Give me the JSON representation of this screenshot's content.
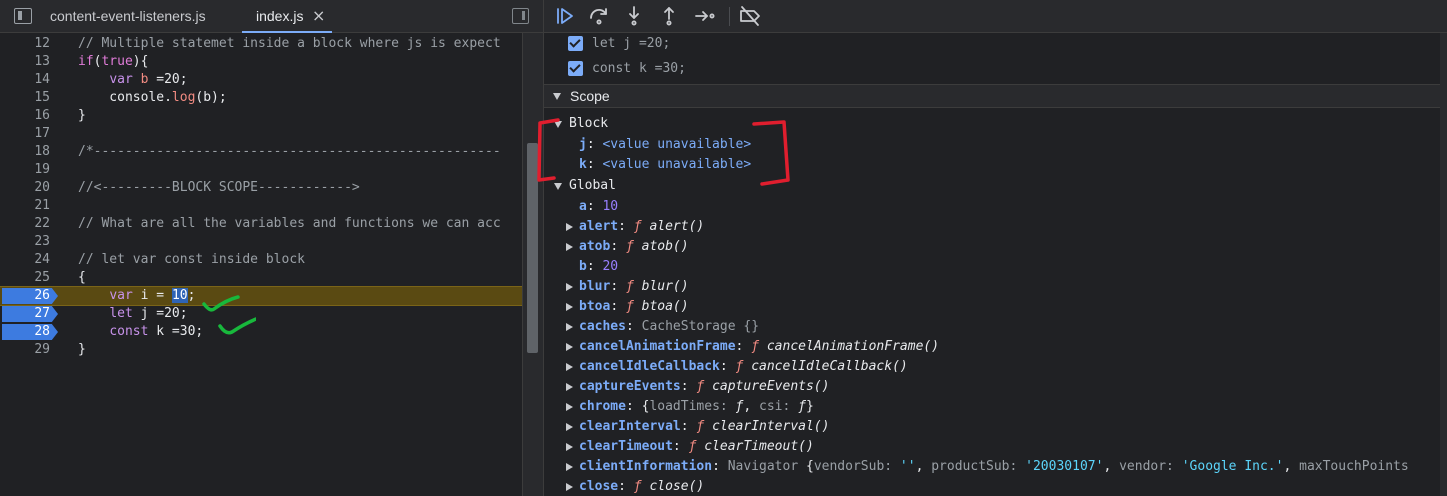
{
  "editor": {
    "tabs": [
      {
        "label": "content-event-listeners.js"
      },
      {
        "label": "index.js",
        "close": "×"
      }
    ],
    "lines": [
      {
        "n": "12",
        "parts": [
          {
            "c": "c-cm",
            "t": "// Multiple statemet inside a block where js is expect"
          }
        ]
      },
      {
        "n": "13",
        "parts": [
          {
            "c": "c-kw2",
            "t": "if"
          },
          {
            "c": "c-nm",
            "t": "("
          },
          {
            "c": "c-kw2",
            "t": "true"
          },
          {
            "c": "c-nm",
            "t": "){"
          }
        ]
      },
      {
        "n": "14",
        "parts": [
          {
            "c": "c-nm",
            "t": "    "
          },
          {
            "c": "c-kw",
            "t": "var"
          },
          {
            "c": "c-nm",
            "t": " "
          },
          {
            "c": "c-fn",
            "t": "b"
          },
          {
            "c": "c-nm",
            "t": " =20;"
          }
        ]
      },
      {
        "n": "15",
        "parts": [
          {
            "c": "c-nm",
            "t": "    console."
          },
          {
            "c": "c-fn",
            "t": "log"
          },
          {
            "c": "c-nm",
            "t": "(b);"
          }
        ]
      },
      {
        "n": "16",
        "parts": [
          {
            "c": "c-nm",
            "t": "}"
          }
        ]
      },
      {
        "n": "17",
        "parts": []
      },
      {
        "n": "18",
        "parts": [
          {
            "c": "c-cm",
            "t": "/*----------------------------------------------------"
          }
        ]
      },
      {
        "n": "19",
        "parts": []
      },
      {
        "n": "20",
        "parts": [
          {
            "c": "c-cm",
            "t": "//<---------BLOCK SCOPE------------>"
          }
        ]
      },
      {
        "n": "21",
        "parts": []
      },
      {
        "n": "22",
        "parts": [
          {
            "c": "c-cm",
            "t": "// What are all the variables and functions we can acc"
          }
        ]
      },
      {
        "n": "23",
        "parts": []
      },
      {
        "n": "24",
        "parts": [
          {
            "c": "c-cm",
            "t": "// let var const inside block"
          }
        ]
      },
      {
        "n": "25",
        "parts": [
          {
            "c": "c-nm",
            "t": "{"
          }
        ]
      },
      {
        "n": "26",
        "bp": true,
        "active": true,
        "parts": [
          {
            "c": "c-nm",
            "t": "    "
          },
          {
            "c": "c-kw",
            "t": "var"
          },
          {
            "c": "c-nm",
            "t": " i = "
          },
          {
            "c": "c-hl",
            "t": "10"
          },
          {
            "c": "c-nm",
            "t": ";"
          }
        ]
      },
      {
        "n": "27",
        "bp": true,
        "parts": [
          {
            "c": "c-nm",
            "t": "    "
          },
          {
            "c": "c-kw",
            "t": "let"
          },
          {
            "c": "c-nm",
            "t": " j =20;"
          }
        ]
      },
      {
        "n": "28",
        "bp": true,
        "parts": [
          {
            "c": "c-nm",
            "t": "    "
          },
          {
            "c": "c-kw",
            "t": "const"
          },
          {
            "c": "c-nm",
            "t": " k =30;"
          }
        ]
      },
      {
        "n": "29",
        "parts": [
          {
            "c": "c-nm",
            "t": "}"
          }
        ]
      }
    ]
  },
  "debugger": {
    "toolbar": [
      {
        "name": "resume-icon",
        "cls": "resume"
      },
      {
        "name": "step-over-icon",
        "cls": ""
      },
      {
        "name": "step-into-icon",
        "cls": ""
      },
      {
        "name": "step-out-icon",
        "cls": ""
      },
      {
        "name": "step-icon",
        "cls": ""
      },
      {
        "name": "deactivate-breakpoints-icon",
        "cls": ""
      }
    ],
    "watch": [
      {
        "label": "let j =20;"
      },
      {
        "label": "const k =30;"
      }
    ],
    "scope_title": "Scope",
    "block_title": "Block",
    "block_props": [
      {
        "key": "j",
        "value": "<value unavailable>"
      },
      {
        "key": "k",
        "value": "<value unavailable>"
      }
    ],
    "global_title": "Global",
    "global_props": [
      {
        "arrow": false,
        "key": "a",
        "parts": [
          {
            "c": "pnum",
            "t": "10"
          }
        ]
      },
      {
        "arrow": true,
        "key": "alert",
        "parts": [
          {
            "c": "pfk",
            "t": "ƒ "
          },
          {
            "c": "pfn",
            "t": "alert()"
          }
        ]
      },
      {
        "arrow": true,
        "key": "atob",
        "parts": [
          {
            "c": "pfk",
            "t": "ƒ "
          },
          {
            "c": "pfn",
            "t": "atob()"
          }
        ]
      },
      {
        "arrow": false,
        "key": "b",
        "parts": [
          {
            "c": "pnum",
            "t": "20"
          }
        ]
      },
      {
        "arrow": true,
        "key": "blur",
        "parts": [
          {
            "c": "pfk",
            "t": "ƒ "
          },
          {
            "c": "pfn",
            "t": "blur()"
          }
        ]
      },
      {
        "arrow": true,
        "key": "btoa",
        "parts": [
          {
            "c": "pfk",
            "t": "ƒ "
          },
          {
            "c": "pfn",
            "t": "btoa()"
          }
        ]
      },
      {
        "arrow": true,
        "key": "caches",
        "parts": [
          {
            "c": "pobj",
            "t": "CacheStorage {}"
          }
        ]
      },
      {
        "arrow": true,
        "key": "cancelAnimationFrame",
        "parts": [
          {
            "c": "pfk",
            "t": "ƒ "
          },
          {
            "c": "pfn",
            "t": "cancelAnimationFrame()"
          }
        ]
      },
      {
        "arrow": true,
        "key": "cancelIdleCallback",
        "parts": [
          {
            "c": "pfk",
            "t": "ƒ "
          },
          {
            "c": "pfn",
            "t": "cancelIdleCallback()"
          }
        ]
      },
      {
        "arrow": true,
        "key": "captureEvents",
        "parts": [
          {
            "c": "pfk",
            "t": "ƒ "
          },
          {
            "c": "pfn",
            "t": "captureEvents()"
          }
        ]
      },
      {
        "arrow": true,
        "key": "chrome",
        "parts": [
          {
            "c": "pv",
            "t": "{"
          },
          {
            "c": "pobj",
            "t": "loadTimes: "
          },
          {
            "c": "pfn",
            "t": "ƒ"
          },
          {
            "c": "pv",
            "t": ", "
          },
          {
            "c": "pobj",
            "t": "csi: "
          },
          {
            "c": "pfn",
            "t": "ƒ"
          },
          {
            "c": "pv",
            "t": "}"
          }
        ]
      },
      {
        "arrow": true,
        "key": "clearInterval",
        "parts": [
          {
            "c": "pfk",
            "t": "ƒ "
          },
          {
            "c": "pfn",
            "t": "clearInterval()"
          }
        ]
      },
      {
        "arrow": true,
        "key": "clearTimeout",
        "parts": [
          {
            "c": "pfk",
            "t": "ƒ "
          },
          {
            "c": "pfn",
            "t": "clearTimeout()"
          }
        ]
      },
      {
        "arrow": true,
        "key": "clientInformation",
        "parts": [
          {
            "c": "pobj",
            "t": "Navigator "
          },
          {
            "c": "pv",
            "t": "{"
          },
          {
            "c": "pobj",
            "t": "vendorSub: "
          },
          {
            "c": "pstr",
            "t": "''"
          },
          {
            "c": "pv",
            "t": ", "
          },
          {
            "c": "pobj",
            "t": "productSub: "
          },
          {
            "c": "pstr",
            "t": "'20030107'"
          },
          {
            "c": "pv",
            "t": ", "
          },
          {
            "c": "pobj",
            "t": "vendor: "
          },
          {
            "c": "pstr",
            "t": "'Google Inc.'"
          },
          {
            "c": "pv",
            "t": ", "
          },
          {
            "c": "pobj",
            "t": "maxTouchPoints"
          }
        ]
      },
      {
        "arrow": true,
        "key": "close",
        "parts": [
          {
            "c": "pfk",
            "t": "ƒ "
          },
          {
            "c": "pfn",
            "t": "close()"
          }
        ]
      }
    ]
  }
}
